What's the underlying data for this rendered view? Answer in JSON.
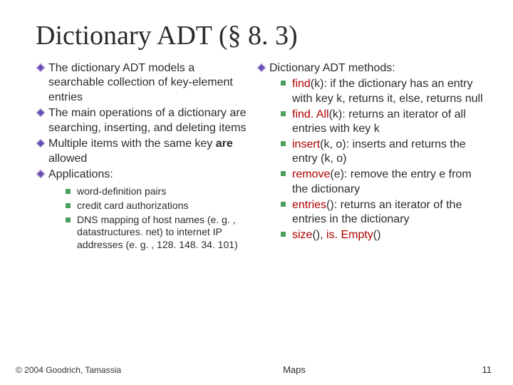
{
  "title": "Dictionary ADT (§ 8. 3)",
  "left": {
    "items": [
      "The dictionary ADT models a searchable collection of key-element entries",
      "The main operations of a dictionary are searching, inserting, and deleting items",
      "Multiple items with the same key <b>are</b> allowed",
      "Applications:"
    ],
    "sub": [
      "word-definition pairs",
      "credit card authorizations",
      "DNS mapping of host names (e. g. , datastructures. net) to internet IP addresses (e. g. , 128. 148. 34. 101)"
    ]
  },
  "right": {
    "header": "Dictionary ADT methods:",
    "methods": [
      "<span class=\"red\">find</span>(k): if the dictionary has an entry with key k, returns it, else, returns null",
      "<span class=\"red\">find. All</span>(k): returns an iterator of all entries with key k",
      "<span class=\"red\">insert</span>(k, o): inserts and returns the entry (k, o)",
      "<span class=\"red\">remove</span>(e): remove the entry e from the dictionary",
      "<span class=\"red\">entries</span>(): returns an iterator of the entries in the dictionary",
      "<span class=\"red\">size</span>(), <span class=\"red\">is. Empty</span>()"
    ]
  },
  "footer": {
    "copyright": "© 2004 Goodrich, Tamassia",
    "center": "Maps",
    "page": "11"
  }
}
